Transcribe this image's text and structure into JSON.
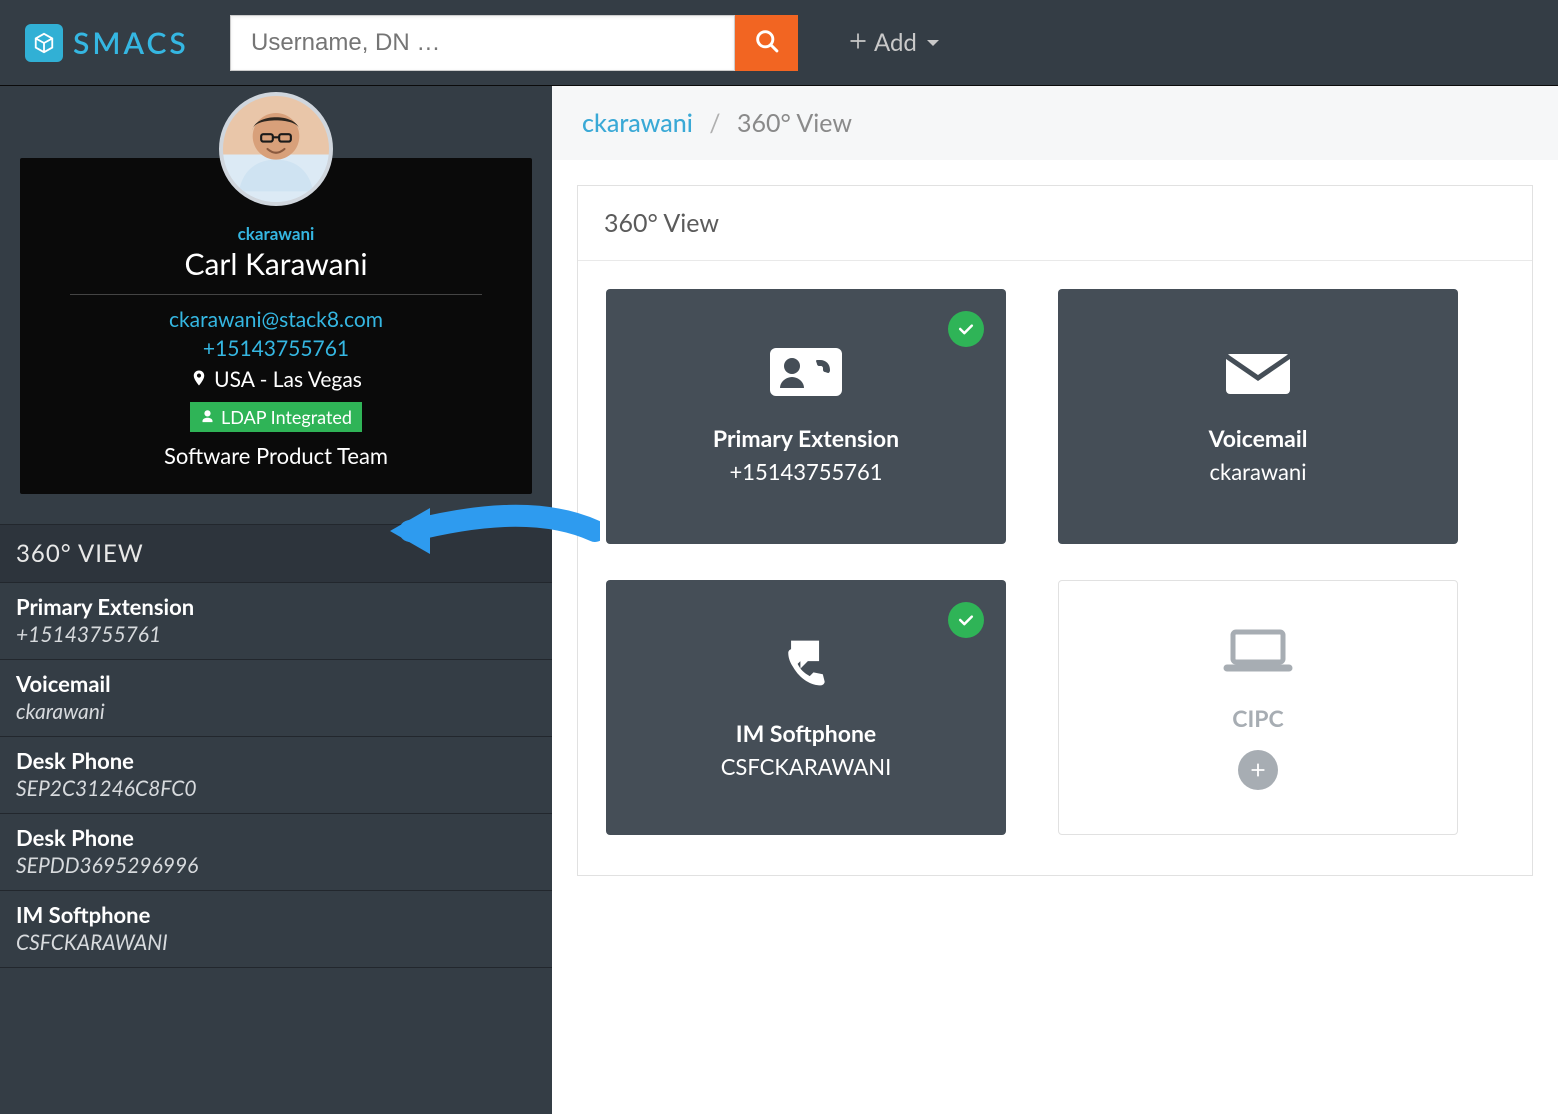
{
  "brand": {
    "name": "SMACS"
  },
  "navbar": {
    "search_placeholder": "Username, DN …",
    "add_label": "Add"
  },
  "profile": {
    "username": "ckarawani",
    "full_name": "Carl Karawani",
    "email": "ckarawani@stack8.com",
    "phone": "+15143755761",
    "location": "USA - Las Vegas",
    "ldap_badge": "LDAP Integrated",
    "team": "Software Product Team"
  },
  "side_list": {
    "heading": "360° VIEW",
    "items": [
      {
        "title": "Primary Extension",
        "value": "+15143755761"
      },
      {
        "title": "Voicemail",
        "value": "ckarawani"
      },
      {
        "title": "Desk Phone",
        "value": "SEP2C31246C8FC0"
      },
      {
        "title": "Desk Phone",
        "value": "SEPDD3695296996"
      },
      {
        "title": "IM Softphone",
        "value": "CSFCKARAWANI"
      }
    ]
  },
  "breadcrumb": {
    "link": "ckarawani",
    "current": "360° View"
  },
  "panel": {
    "heading": "360° View"
  },
  "tiles": [
    {
      "kind": "dark",
      "icon": "contact-phone-icon",
      "title": "Primary Extension",
      "sub": "+15143755761",
      "check": true
    },
    {
      "kind": "dark",
      "icon": "envelope-icon",
      "title": "Voicemail",
      "sub": "ckarawani",
      "check": false
    },
    {
      "kind": "dark",
      "icon": "softphone-icon",
      "title": "IM Softphone",
      "sub": "CSFCKARAWANI",
      "check": true
    },
    {
      "kind": "light",
      "icon": "laptop-icon",
      "title": "CIPC",
      "sub": "",
      "check": false,
      "add": true
    }
  ]
}
